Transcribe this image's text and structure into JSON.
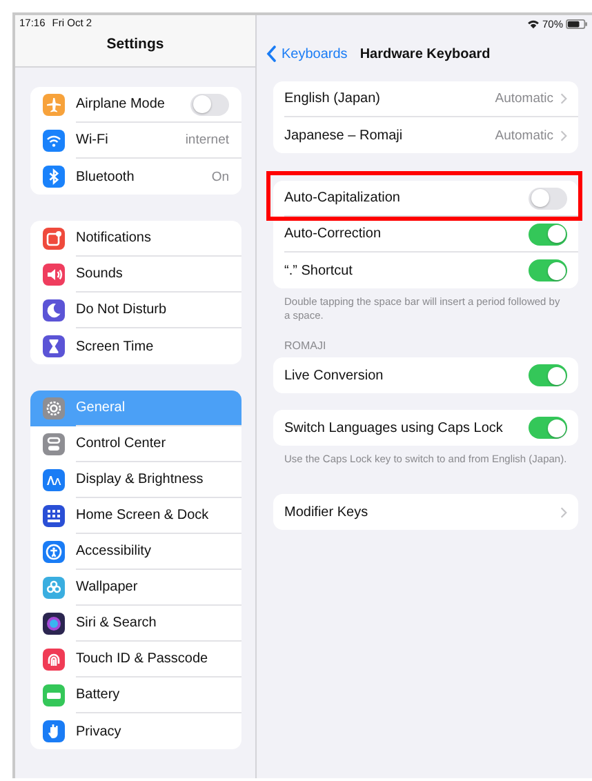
{
  "status_bar": {
    "time": "17:16",
    "date": "Fri Oct 2",
    "battery": "70%"
  },
  "sidebar": {
    "title": "Settings",
    "groups": [
      {
        "items": [
          {
            "label": "Airplane Mode",
            "kind": "toggle",
            "on": false,
            "selected": false,
            "color": "#f7a23b"
          },
          {
            "label": "Wi-Fi",
            "kind": "value",
            "value": "internet",
            "selected": false,
            "color": "#1a82fb"
          },
          {
            "label": "Bluetooth",
            "kind": "value",
            "value": "On",
            "selected": false,
            "color": "#1a82fb"
          }
        ]
      },
      {
        "items": [
          {
            "label": "Notifications",
            "kind": "plain",
            "selected": false,
            "color": "#ef4a3c"
          },
          {
            "label": "Sounds",
            "kind": "plain",
            "selected": false,
            "color": "#ef3d5e"
          },
          {
            "label": "Do Not Disturb",
            "kind": "plain",
            "selected": false,
            "color": "#5b54d6"
          },
          {
            "label": "Screen Time",
            "kind": "plain",
            "selected": false,
            "color": "#5b54d6"
          }
        ]
      },
      {
        "items": [
          {
            "label": "General",
            "kind": "plain",
            "selected": true,
            "color": "#8e8e93"
          },
          {
            "label": "Control Center",
            "kind": "plain",
            "selected": false,
            "color": "#8e8e93"
          },
          {
            "label": "Display & Brightness",
            "kind": "plain",
            "selected": false,
            "color": "#1a7cf5"
          },
          {
            "label": "Home Screen & Dock",
            "kind": "plain",
            "selected": false,
            "color": "#2a4fd6"
          },
          {
            "label": "Accessibility",
            "kind": "plain",
            "selected": false,
            "color": "#1a7cf5"
          },
          {
            "label": "Wallpaper",
            "kind": "plain",
            "selected": false,
            "color": "#3aaee0"
          },
          {
            "label": "Siri & Search",
            "kind": "plain",
            "selected": false,
            "color": "#2b2550"
          },
          {
            "label": "Touch ID & Passcode",
            "kind": "plain",
            "selected": false,
            "color": "#f03b55"
          },
          {
            "label": "Battery",
            "kind": "plain",
            "selected": false,
            "color": "#34c759"
          },
          {
            "label": "Privacy",
            "kind": "plain",
            "selected": false,
            "color": "#1a7cf5"
          }
        ]
      }
    ]
  },
  "detail": {
    "back": "Keyboards",
    "title": "Hardware Keyboard",
    "sections": [
      {
        "rows": [
          {
            "label": "English (Japan)",
            "kind": "value",
            "value": "Automatic"
          },
          {
            "label": "Japanese – Romaji",
            "kind": "value",
            "value": "Automatic"
          }
        ]
      },
      {
        "rows": [
          {
            "label": "Auto-Capitalization",
            "kind": "toggle",
            "on": false,
            "highlighted": true
          },
          {
            "label": "Auto-Correction",
            "kind": "toggle",
            "on": true,
            "highlighted": false
          },
          {
            "label": "“.” Shortcut",
            "kind": "toggle",
            "on": true,
            "highlighted": false
          }
        ],
        "footer": "Double tapping the space bar will insert a period followed by a space."
      },
      {
        "header": "ROMAJI",
        "rows": [
          {
            "label": "Live Conversion",
            "kind": "toggle",
            "on": true,
            "highlighted": false
          }
        ]
      },
      {
        "rows": [
          {
            "label": "Switch Languages using Caps Lock",
            "kind": "toggle",
            "on": true,
            "highlighted": false
          }
        ],
        "footer": "Use the Caps Lock key to switch to and from English (Japan)."
      },
      {
        "rows": [
          {
            "label": "Modifier Keys",
            "kind": "chevron"
          }
        ]
      }
    ]
  }
}
